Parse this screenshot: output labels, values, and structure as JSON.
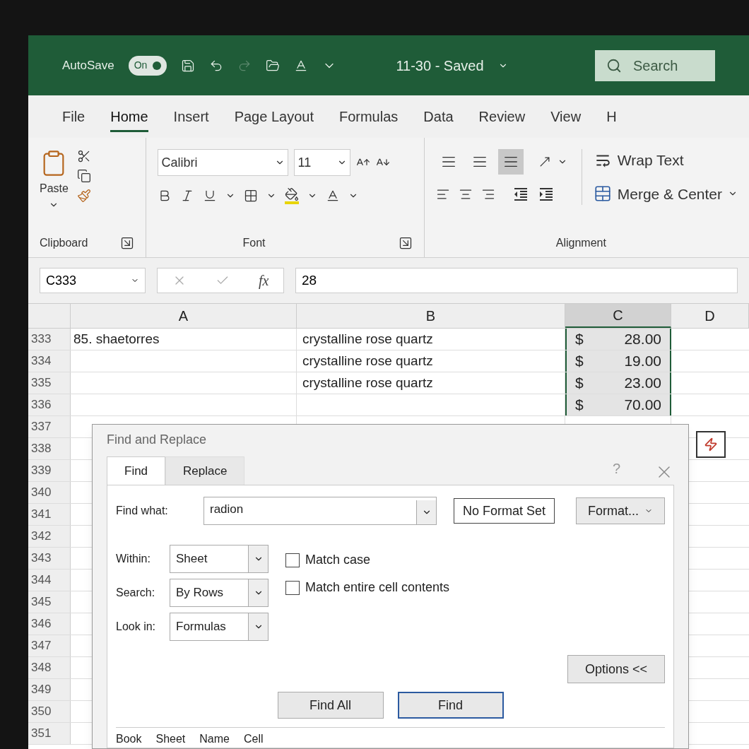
{
  "title_bar": {
    "autosave": {
      "label": "AutoSave",
      "toggle_text": "On",
      "on": true
    },
    "title": "11-30 - Saved",
    "search": {
      "placeholder": "Search"
    }
  },
  "tabs": [
    {
      "label": "File",
      "selected": false
    },
    {
      "label": "Home",
      "selected": true
    },
    {
      "label": "Insert",
      "selected": false
    },
    {
      "label": "Page Layout",
      "selected": false
    },
    {
      "label": "Formulas",
      "selected": false
    },
    {
      "label": "Data",
      "selected": false
    },
    {
      "label": "Review",
      "selected": false
    },
    {
      "label": "View",
      "selected": false
    },
    {
      "label": "H",
      "selected": false
    }
  ],
  "ribbon": {
    "clipboard": {
      "paste_label": "Paste",
      "group_label": "Clipboard"
    },
    "font": {
      "font_name": "Calibri",
      "font_size": "11",
      "group_label": "Font"
    },
    "alignment": {
      "vertical_align": [
        {
          "selected": false
        },
        {
          "selected": false
        },
        {
          "selected": true
        }
      ],
      "wrap_text": "Wrap Text",
      "merge": "Merge & Center",
      "group_label": "Alignment"
    }
  },
  "formula_bar": {
    "name_box": "C333",
    "function_label": "fx",
    "formula": "28"
  },
  "sheet": {
    "columns": [
      {
        "label": "A",
        "selected": false
      },
      {
        "label": "B",
        "selected": false
      },
      {
        "label": "C",
        "selected": true
      },
      {
        "label": "D",
        "selected": false
      }
    ],
    "rows": [
      {
        "number": "333",
        "a": "85. shaetorres",
        "b": "crystalline rose quartz",
        "currency": "$",
        "amount": "28.00",
        "selected": true
      },
      {
        "number": "334",
        "b": "crystalline rose quartz",
        "currency": "$",
        "amount": "19.00",
        "selected": true
      },
      {
        "number": "335",
        "b": "crystalline rose quartz",
        "currency": "$",
        "amount": "23.00",
        "selected": true
      },
      {
        "number": "336",
        "currency": "$",
        "amount": "70.00",
        "selected": true
      }
    ],
    "more_row_numbers": [
      "337",
      "338",
      "339",
      "340",
      "341",
      "342",
      "343",
      "344",
      "345",
      "346",
      "347",
      "348",
      "349",
      "350",
      "351"
    ]
  },
  "dialog": {
    "title": "Find and Replace",
    "help": "?",
    "tabs": [
      {
        "label": "Find",
        "selected": true
      },
      {
        "label": "Replace",
        "selected": false
      }
    ],
    "find_what": {
      "label": "Find what:",
      "value": "radion"
    },
    "format_status": "No Format Set",
    "format_button": "Format...",
    "dropdowns": [
      {
        "label": "Within:",
        "value": "Sheet"
      },
      {
        "label": "Search:",
        "value": "By Rows"
      },
      {
        "label": "Look in:",
        "value": "Formulas"
      }
    ],
    "checkboxes": [
      {
        "label": "Match case",
        "checked": false
      },
      {
        "label": "Match entire cell contents",
        "checked": false
      }
    ],
    "options_button": "Options <<",
    "buttons": [
      "Find All",
      "Find"
    ],
    "results_columns": [
      "Book",
      "Sheet",
      "Name",
      "Cell"
    ]
  }
}
